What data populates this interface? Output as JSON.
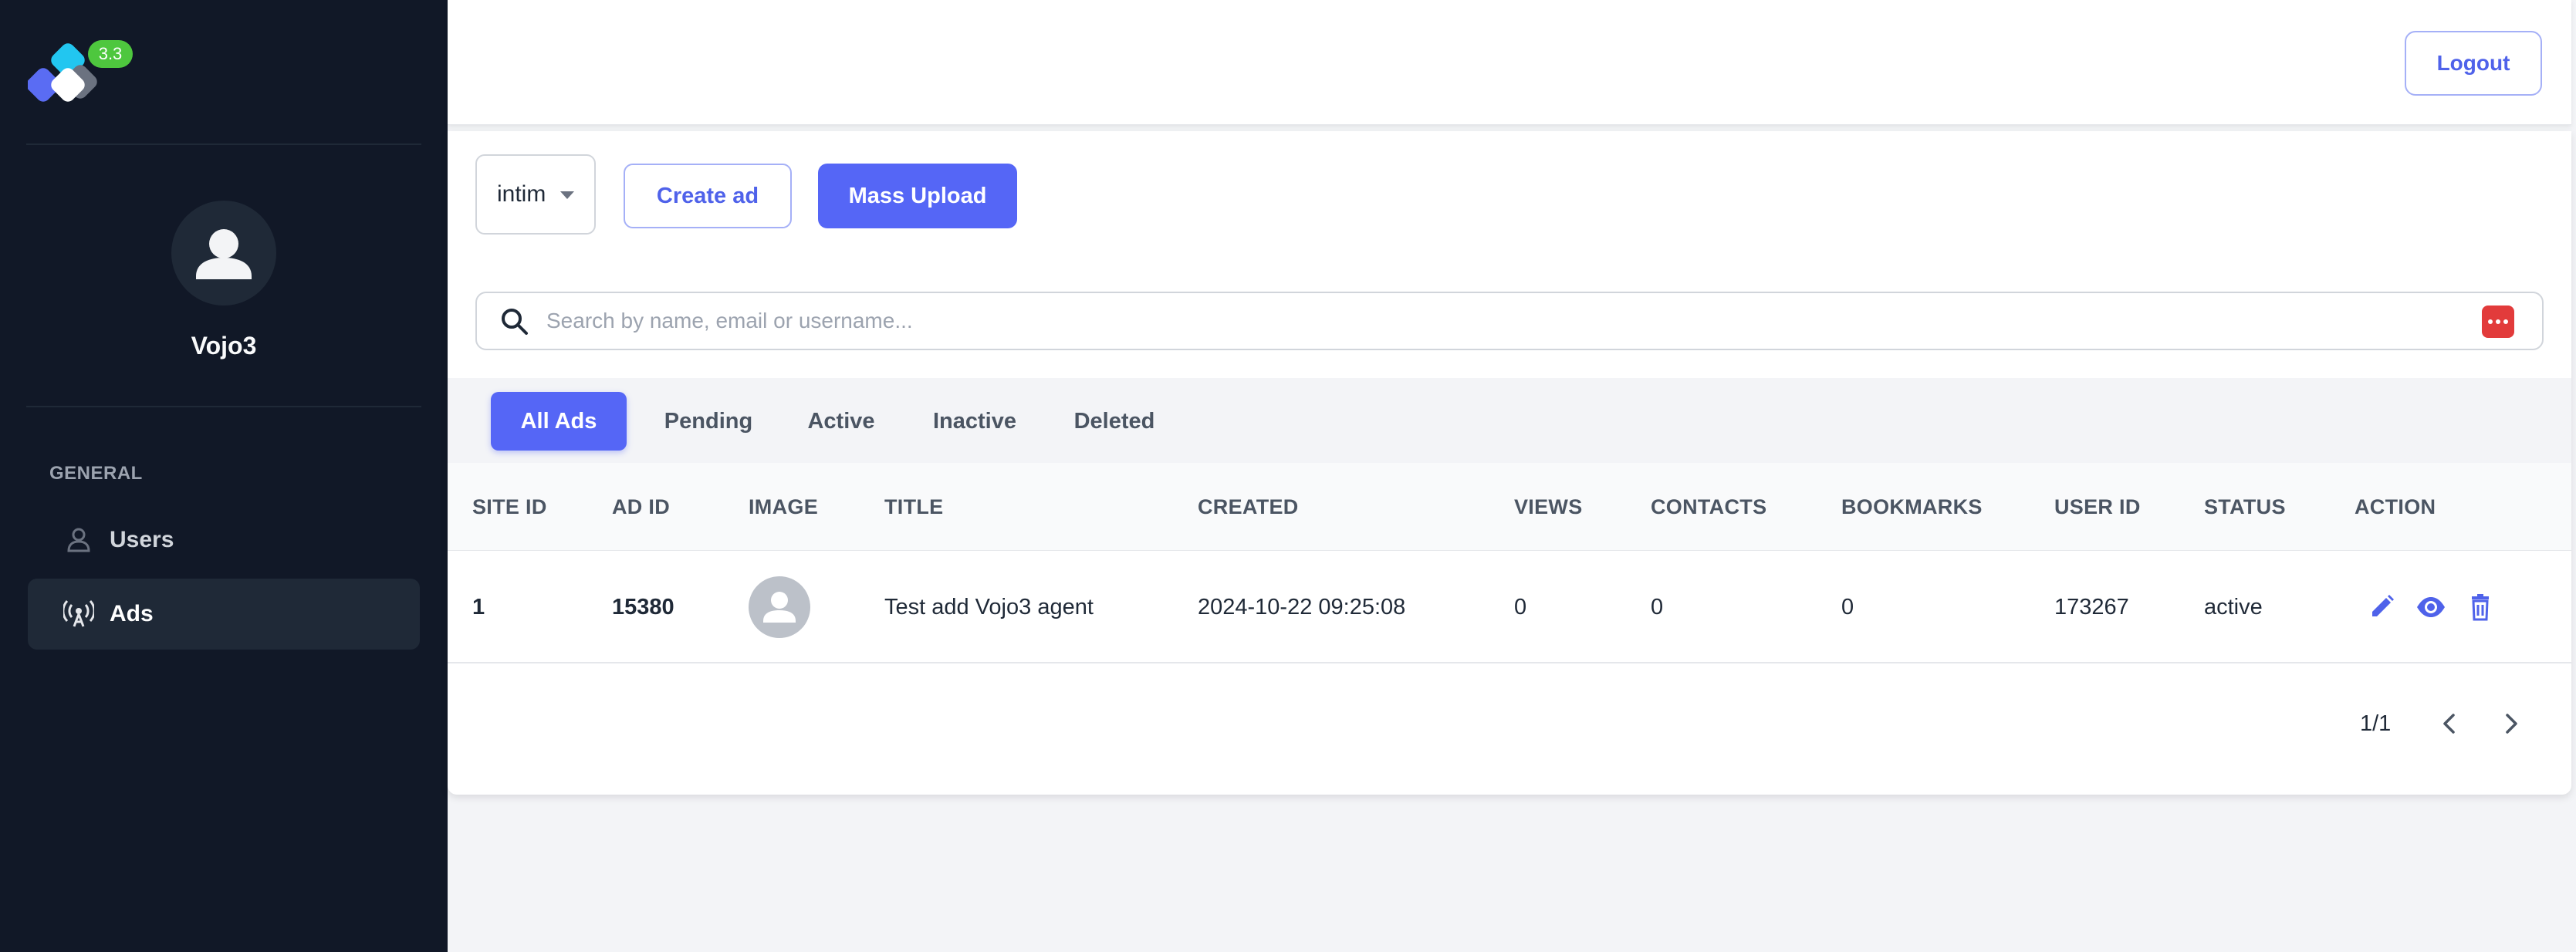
{
  "app": {
    "version_badge": "3.3"
  },
  "sidebar": {
    "user_name": "Vojo3",
    "section_label": "GENERAL",
    "items": [
      {
        "label": "Users",
        "icon": "user-outline-icon",
        "active": false
      },
      {
        "label": "Ads",
        "icon": "broadcast-antenna-icon",
        "active": true
      }
    ]
  },
  "header": {
    "logout_label": "Logout"
  },
  "toolbar": {
    "site_select_value": "intim",
    "create_ad_label": "Create ad",
    "mass_upload_label": "Mass Upload"
  },
  "search": {
    "placeholder": "Search by name, email or username...",
    "value": ""
  },
  "tabs": [
    {
      "label": "All Ads",
      "active": true
    },
    {
      "label": "Pending",
      "active": false
    },
    {
      "label": "Active",
      "active": false
    },
    {
      "label": "Inactive",
      "active": false
    },
    {
      "label": "Deleted",
      "active": false
    }
  ],
  "table": {
    "columns": [
      "SITE ID",
      "AD ID",
      "IMAGE",
      "TITLE",
      "CREATED",
      "VIEWS",
      "CONTACTS",
      "BOOKMARKS",
      "USER ID",
      "STATUS",
      "ACTION"
    ],
    "rows": [
      {
        "site_id": "1",
        "ad_id": "15380",
        "title": "Test add Vojo3 agent",
        "created": "2024-10-22 09:25:08",
        "views": "0",
        "contacts": "0",
        "bookmarks": "0",
        "user_id": "173267",
        "status": "active"
      }
    ]
  },
  "pagination": {
    "text": "1/1"
  },
  "colors": {
    "sidebar_bg": "#111827",
    "accent": "#5566f6",
    "badge_green": "#4ec73e"
  }
}
